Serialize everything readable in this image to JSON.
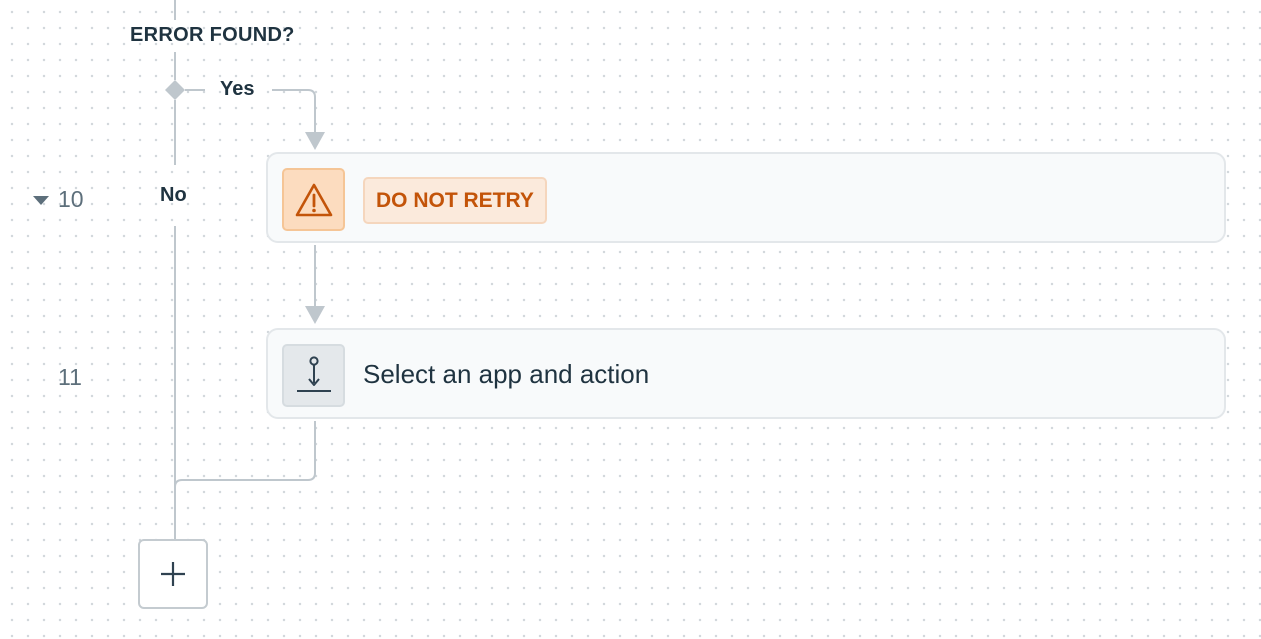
{
  "condition": {
    "label": "ERROR FOUND?",
    "yes_label": "Yes",
    "no_label": "No"
  },
  "steps": [
    {
      "number": "10",
      "collapsible": true,
      "icon": "warning-icon",
      "action_label": "DO NOT RETRY",
      "accent_color": "#c35409"
    },
    {
      "number": "11",
      "icon": "app-placeholder-icon",
      "title": "Select an app and action"
    }
  ],
  "add_step": {
    "icon": "plus-icon"
  },
  "colors": {
    "connector": "#bfc7cd",
    "text": "#1f3340",
    "step_number": "#5d6f7b",
    "warning_bg": "#fcdcbf",
    "warning_text": "#c35409"
  }
}
